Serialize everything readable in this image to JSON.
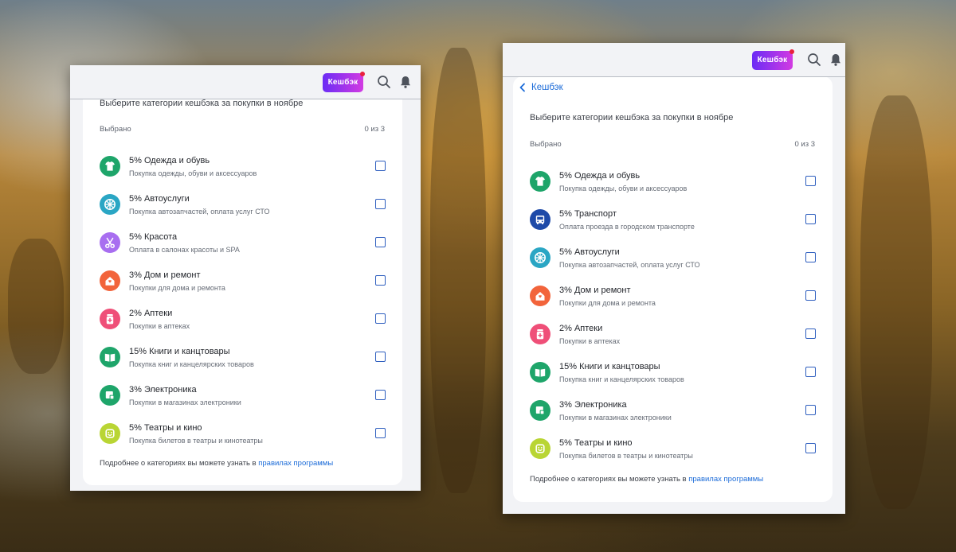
{
  "header": {
    "cashback_label": "Кешбэк"
  },
  "icons": {
    "search": "search-icon",
    "bell": "bell-icon"
  },
  "left_window": {
    "title": "Выберите категории кешбэка за покупки в ноябре",
    "selected_label": "Выбрано",
    "selected_count": "0 из 3",
    "items": [
      {
        "name": "5% Одежда и обувь",
        "desc": "Покупка одежды, обуви и аксессуаров",
        "icon": "tshirt-icon",
        "color": "#1ea56a"
      },
      {
        "name": "5% Автоуслуги",
        "desc": "Покупка автозапчастей, оплата услуг СТО",
        "icon": "wheel-icon",
        "color": "#2aa6c4"
      },
      {
        "name": "5% Красота",
        "desc": "Оплата в салонах красоты и SPA",
        "icon": "scissors-icon",
        "color": "#a86ef0"
      },
      {
        "name": "3% Дом и ремонт",
        "desc": "Покупки для дома и ремонта",
        "icon": "house-icon",
        "color": "#f2643b"
      },
      {
        "name": "2% Аптеки",
        "desc": "Покупки в аптеках",
        "icon": "medicine-icon",
        "color": "#ef4f78"
      },
      {
        "name": "15% Книги и канцтовары",
        "desc": "Покупка книг и канцелярских товаров",
        "icon": "book-icon",
        "color": "#1ea56a"
      },
      {
        "name": "3% Электроника",
        "desc": "Покупки в магазинах электроники",
        "icon": "electronics-icon",
        "color": "#1ea56a"
      },
      {
        "name": "5% Театры и кино",
        "desc": "Покупка билетов в театры и кинотеатры",
        "icon": "smile-icon",
        "color": "#b9d534"
      }
    ],
    "footer_text": "Подробнее о категориях вы можете узнать в ",
    "footer_link": "правилах программы"
  },
  "right_window": {
    "back_label": "Кешбэк",
    "title": "Выберите категории кешбэка за покупки в ноябре",
    "selected_label": "Выбрано",
    "selected_count": "0 из 3",
    "items": [
      {
        "name": "5% Одежда и обувь",
        "desc": "Покупка одежды, обуви и аксессуаров",
        "icon": "tshirt-icon",
        "color": "#1ea56a"
      },
      {
        "name": "5% Транспорт",
        "desc": "Оплата проезда в городском транспорте",
        "icon": "bus-icon",
        "color": "#1e4aa8"
      },
      {
        "name": "5% Автоуслуги",
        "desc": "Покупка автозапчастей, оплата услуг СТО",
        "icon": "wheel-icon",
        "color": "#2aa6c4"
      },
      {
        "name": "3% Дом и ремонт",
        "desc": "Покупки для дома и ремонта",
        "icon": "house-icon",
        "color": "#f2643b"
      },
      {
        "name": "2% Аптеки",
        "desc": "Покупки в аптеках",
        "icon": "medicine-icon",
        "color": "#ef4f78"
      },
      {
        "name": "15% Книги и канцтовары",
        "desc": "Покупка книг и канцелярских товаров",
        "icon": "book-icon",
        "color": "#1ea56a"
      },
      {
        "name": "3% Электроника",
        "desc": "Покупки в магазинах электроники",
        "icon": "electronics-icon",
        "color": "#1ea56a"
      },
      {
        "name": "5% Театры и кино",
        "desc": "Покупка билетов в театры и кинотеатры",
        "icon": "smile-icon",
        "color": "#b9d534"
      }
    ],
    "footer_text": "Подробнее о категориях вы можете узнать в ",
    "footer_link": "правилах программы"
  }
}
